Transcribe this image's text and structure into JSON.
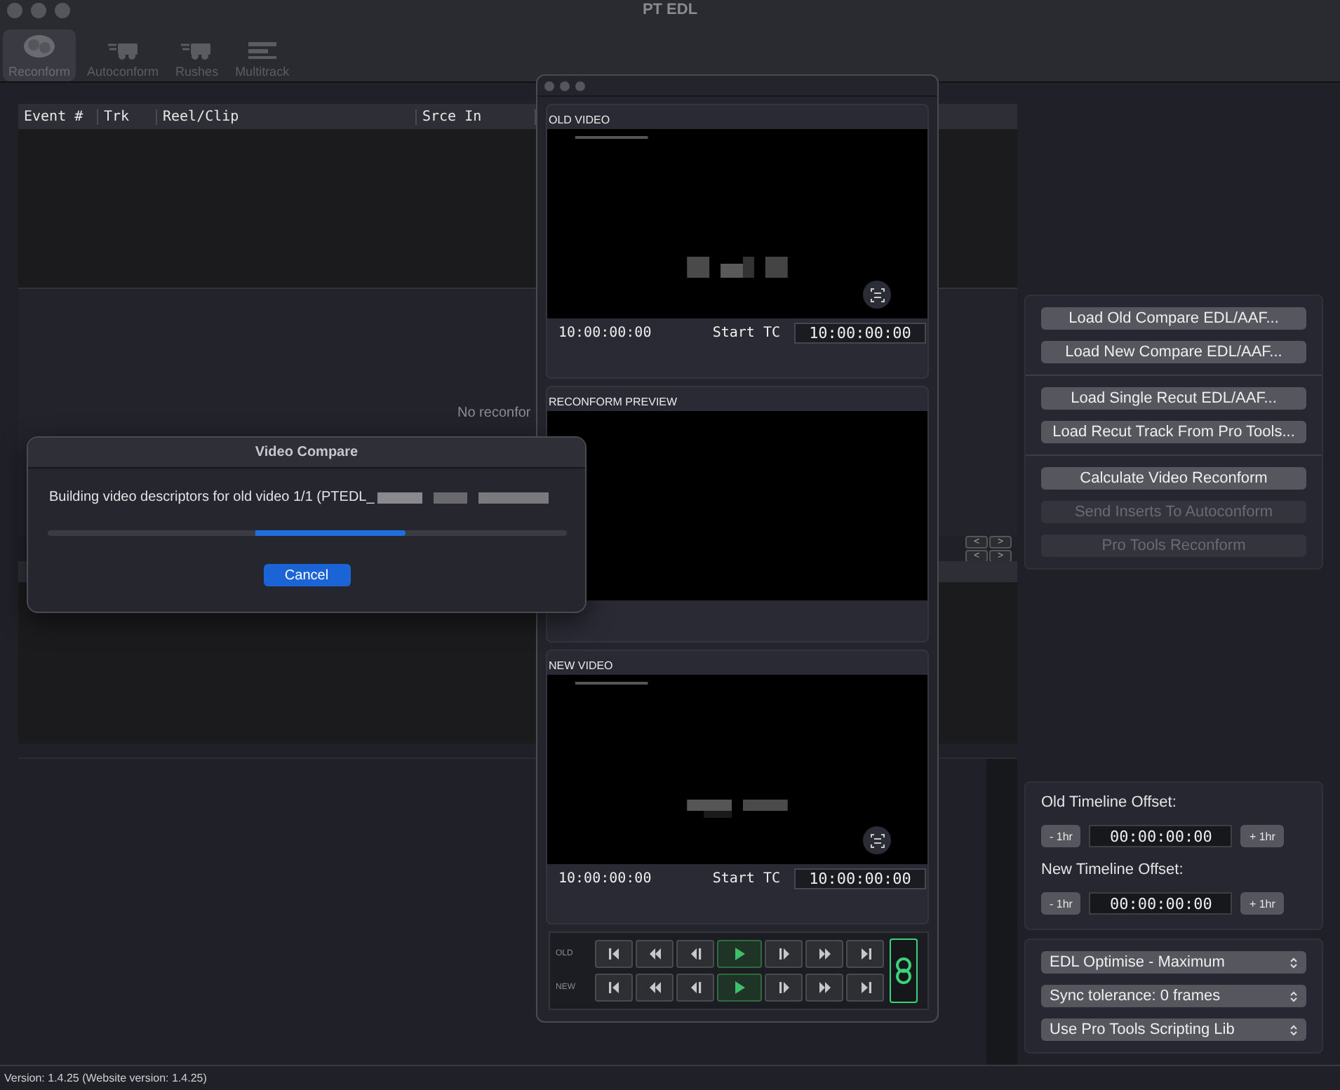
{
  "window": {
    "title": "PT EDL"
  },
  "toolbar": [
    {
      "label": "Reconform",
      "selected": true,
      "kind": "reconform"
    },
    {
      "label": "Autoconform",
      "selected": false,
      "kind": "conform"
    },
    {
      "label": "Rushes",
      "selected": false,
      "kind": "conform"
    },
    {
      "label": "Multitrack",
      "selected": false,
      "kind": "multitrack"
    }
  ],
  "events_table": {
    "columns": [
      "Event #",
      "Trk",
      "Reel/Clip",
      "Srce In"
    ]
  },
  "empty_message": "No reconfor",
  "nav_buttons": [
    "<",
    ">",
    "<",
    ">"
  ],
  "action_groups": [
    [
      {
        "label": "Load Old Compare EDL/AAF...",
        "disabled": false
      },
      {
        "label": "Load New Compare EDL/AAF...",
        "disabled": false
      }
    ],
    [
      {
        "label": "Load Single Recut EDL/AAF...",
        "disabled": false
      },
      {
        "label": "Load Recut Track From Pro Tools...",
        "disabled": false
      }
    ],
    [
      {
        "label": "Calculate Video Reconform",
        "disabled": false
      },
      {
        "label": "Send Inserts To Autoconform",
        "disabled": true
      },
      {
        "label": "Pro Tools Reconform",
        "disabled": true
      }
    ]
  ],
  "offsets": [
    {
      "label": "Old Timeline Offset:",
      "minus": "- 1hr",
      "value": "00:00:00:00",
      "plus": "+ 1hr"
    },
    {
      "label": "New Timeline Offset:",
      "minus": "- 1hr",
      "value": "00:00:00:00",
      "plus": "+ 1hr"
    }
  ],
  "options": [
    "EDL Optimise - Maximum",
    "Sync tolerance: 0 frames",
    "Use Pro Tools Scripting Lib"
  ],
  "status_bar": "Version: 1.4.25  (Website version: 1.4.25)",
  "video_window": {
    "panels": [
      {
        "title": "OLD VIDEO",
        "kind": "video",
        "timecode": "10:00:00:00",
        "start_label": "Start TC",
        "start_value": "10:00:00:00"
      },
      {
        "title": "RECONFORM PREVIEW",
        "kind": "preview"
      },
      {
        "title": "NEW VIDEO",
        "kind": "video",
        "timecode": "10:00:00:00",
        "start_label": "Start TC",
        "start_value": "10:00:00:00"
      }
    ],
    "transport": {
      "rows": [
        "OLD",
        "NEW"
      ],
      "buttons": [
        {
          "kind": "start"
        },
        {
          "kind": "rewind"
        },
        {
          "kind": "step-back"
        },
        {
          "kind": "play"
        },
        {
          "kind": "step-forward"
        },
        {
          "kind": "fast-forward"
        },
        {
          "kind": "end"
        }
      ],
      "linked": true
    }
  },
  "dialog": {
    "title": "Video Compare",
    "message": "Building video descriptors for old video 1/1 (PTEDL_",
    "level": 0.69,
    "button": "Cancel"
  }
}
